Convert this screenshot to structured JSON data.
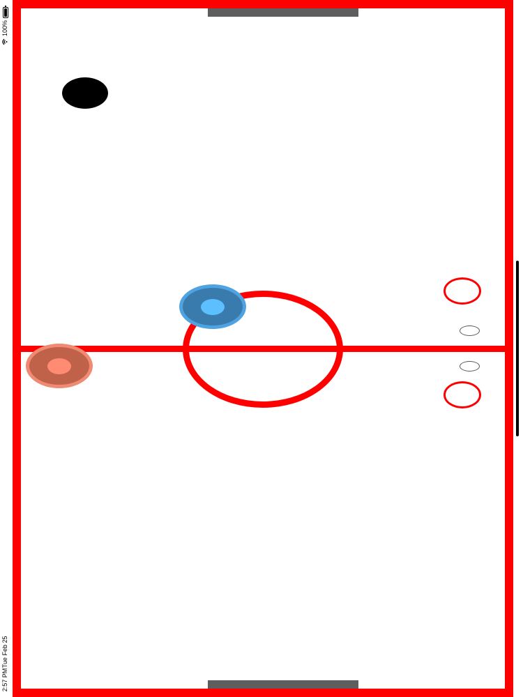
{
  "status_bar": {
    "time": "2:57 PM",
    "date": "Tue Feb 25",
    "battery": "100%",
    "battery_icon": "battery-icon",
    "wifi_icon": "wifi-icon"
  },
  "game": {
    "rink_color": "#ff0000",
    "goal_color": "#5e5e5e",
    "puck_color": "#000000",
    "player_blue": {
      "color": "#3a7bae",
      "accent": "#5cc0ff"
    },
    "player_red": {
      "color": "#c0614a",
      "accent": "#ff8c72"
    }
  }
}
